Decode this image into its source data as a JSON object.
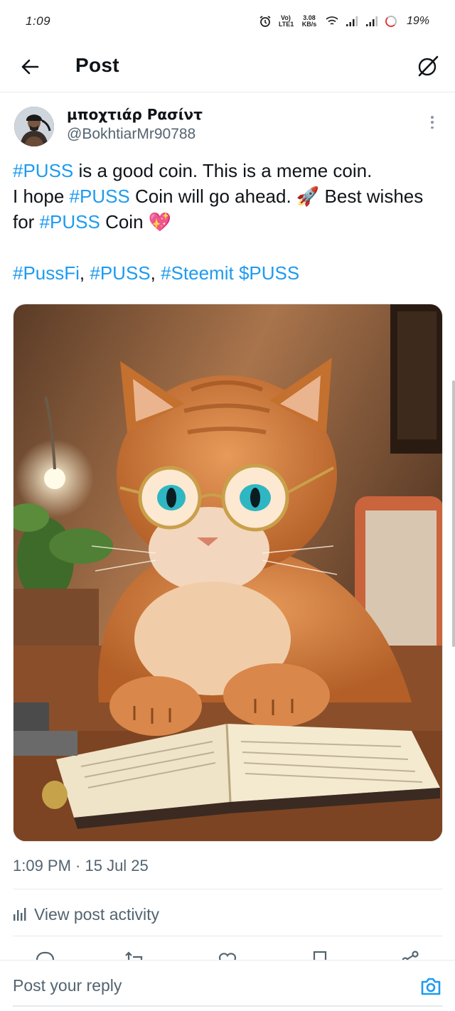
{
  "status_bar": {
    "time": "1:09",
    "volte_label": "Vo) LTE1",
    "data_speed": "3.08 KB/s",
    "battery": "19%"
  },
  "header": {
    "title": "Post"
  },
  "post": {
    "author_name": "μποχτιάρ Ρασίντ",
    "author_handle": "@BokhtiarMr90788",
    "text_line1_tag": "#PUSS",
    "text_line1_rest": " is a good coin. This is a meme coin.",
    "text_line2_pre": "I hope ",
    "text_line2_tag": "#PUSS",
    "text_line2_rest": " Coin will go ahead. 🚀 Best wishes for ",
    "text_line3_tag": "#PUSS",
    "text_line3_rest": " Coin 💖",
    "hashtags": [
      "#PussFi",
      "#PUSS",
      "#Steemit",
      "$PUSS"
    ],
    "hashtag_sep1": ", ",
    "hashtag_sep2": ", ",
    "hashtag_sep3": " ",
    "timestamp": "1:09 PM · 15 Jul 25",
    "view_activity_label": "View post activity"
  },
  "reply": {
    "placeholder": "Post your reply"
  },
  "icons": {
    "back": "arrow-left-icon",
    "grok": "grok-icon",
    "more": "more-vertical-icon",
    "activity": "bar-chart-icon",
    "camera": "camera-icon",
    "reply": "reply-icon",
    "repost": "repost-icon",
    "like": "heart-icon",
    "bookmark": "bookmark-icon",
    "share": "share-icon"
  },
  "colors": {
    "accent": "#1d9bf0",
    "text": "#0f1419",
    "muted": "#536471"
  }
}
